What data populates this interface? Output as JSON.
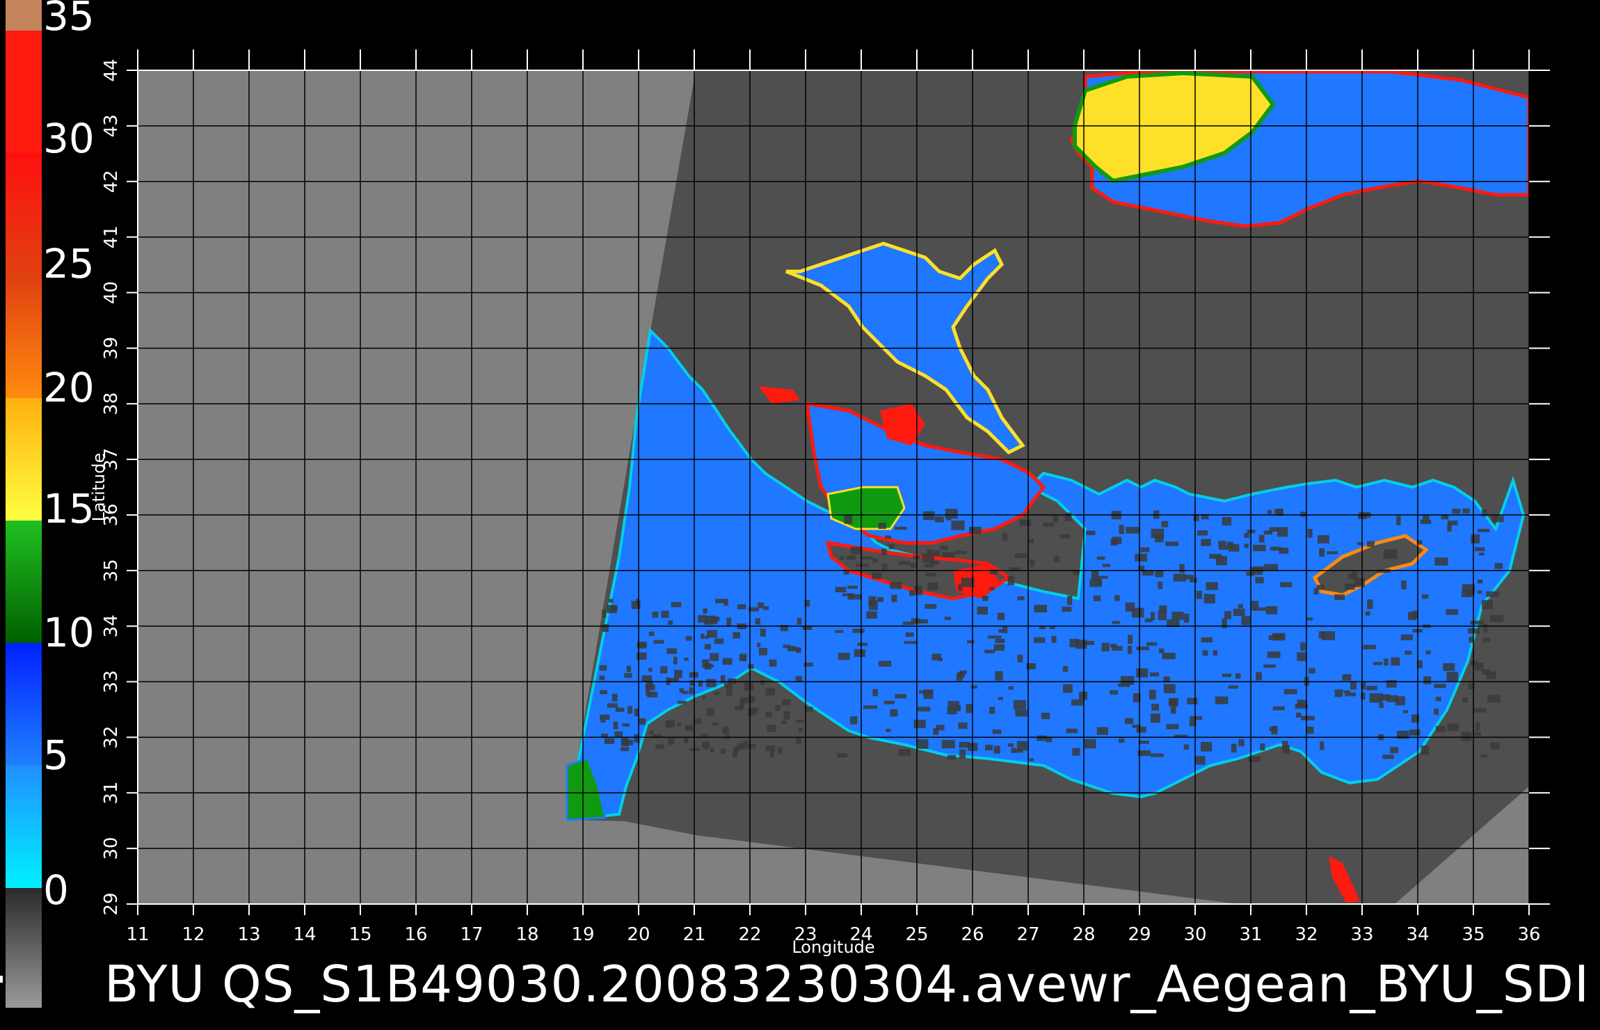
{
  "title": "BYU  QS_S1B49030.20083230304.avewr_Aegean_BYU_SDI",
  "colorbar": {
    "labels": [
      "35",
      "30",
      "25",
      "20",
      "15",
      "10",
      "5",
      "0"
    ],
    "segments": [
      {
        "color": "#c4845c"
      },
      {
        "color": "#ff1a10"
      },
      {
        "color": "#e83a12"
      },
      {
        "color": "#ff8a10"
      },
      {
        "color": "#ffe028"
      },
      {
        "color": "#109a10"
      },
      {
        "color": "#0033ff"
      },
      {
        "color": "#00d8f0"
      },
      {
        "color": "#3a3a3a"
      }
    ]
  },
  "axes": {
    "xlabel": "Longitude",
    "ylabel": "Latitude",
    "x_ticks": [
      "11",
      "12",
      "13",
      "14",
      "15",
      "16",
      "17",
      "18",
      "19",
      "20",
      "21",
      "22",
      "23",
      "24",
      "25",
      "26",
      "27",
      "28",
      "29",
      "30",
      "31",
      "32",
      "33",
      "34",
      "35",
      "36"
    ],
    "y_ticks": [
      "29",
      "30",
      "31",
      "32",
      "33",
      "34",
      "35",
      "36",
      "37",
      "38",
      "39",
      "40",
      "41",
      "42",
      "43",
      "44"
    ],
    "x_range": [
      11,
      36
    ],
    "y_range": [
      29,
      44
    ]
  },
  "colors": {
    "background": "#000000",
    "no_data": "#808080",
    "land": "#4f4f4f",
    "grid": "#000000"
  }
}
